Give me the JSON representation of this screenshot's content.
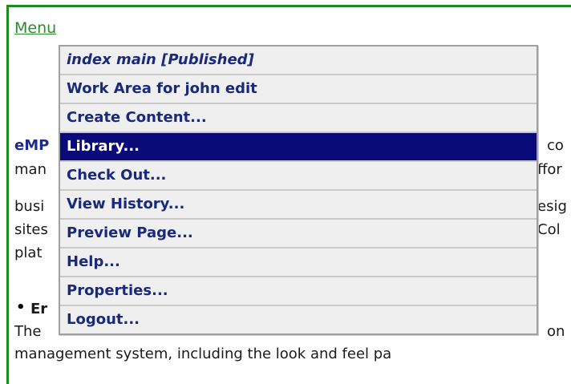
{
  "menu_link": "Menu",
  "dropdown": {
    "items": [
      {
        "label": "index main [Published]"
      },
      {
        "label": "Work Area for john edit"
      },
      {
        "label": "Create Content..."
      },
      {
        "label": "Library..."
      },
      {
        "label": "Check Out..."
      },
      {
        "label": "View History..."
      },
      {
        "label": "Preview Page..."
      },
      {
        "label": "Help..."
      },
      {
        "label": "Properties..."
      },
      {
        "label": "Logout..."
      }
    ]
  },
  "background_text": {
    "l1_left": "eMP",
    "l1_right": "co",
    "l2_left": "man",
    "l2_right": "ffor",
    "l3_left": "busi",
    "l3_right": "esig",
    "l4_left": "sites",
    "l4_right": "Col",
    "l5_left": "plat",
    "heading_left": "Er",
    "l7_left": "The",
    "l7_right": "on",
    "l8": "management system, including the look and feel pa"
  },
  "colors": {
    "highlight": "#0a0a78",
    "menu_text": "#1a2a7a",
    "frame_border": "#1e8a1e"
  }
}
